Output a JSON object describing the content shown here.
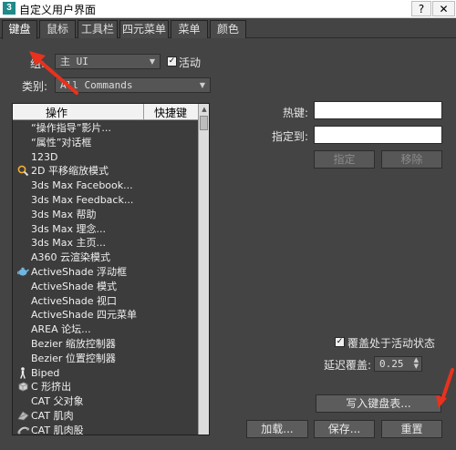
{
  "window": {
    "icon_text": "3",
    "title": "自定义用户界面",
    "help_label": "?",
    "close_label": "✕"
  },
  "tabs": [
    {
      "label": "键盘",
      "active": true
    },
    {
      "label": "鼠标",
      "active": false
    },
    {
      "label": "工具栏",
      "active": false
    },
    {
      "label": "四元菜单",
      "active": false
    },
    {
      "label": "菜单",
      "active": false
    },
    {
      "label": "颜色",
      "active": false
    }
  ],
  "group": {
    "label": "组:",
    "value": "主 UI"
  },
  "active_checkbox": {
    "label": "活动",
    "checked": true,
    "check_glyph": "✓"
  },
  "category": {
    "label": "类别:",
    "value": "All Commands"
  },
  "list": {
    "col_action": "操作",
    "col_shortcut": "快捷键",
    "rows": [
      {
        "text": "“操作指导”影片...",
        "icon": ""
      },
      {
        "text": "“属性”对话框",
        "icon": ""
      },
      {
        "text": "123D",
        "icon": ""
      },
      {
        "text": "2D 平移缩放模式",
        "icon": "magnify-hand-icon"
      },
      {
        "text": "3ds Max Facebook...",
        "icon": ""
      },
      {
        "text": "3ds Max Feedback...",
        "icon": ""
      },
      {
        "text": "3ds Max 帮助",
        "icon": ""
      },
      {
        "text": "3ds Max 理念...",
        "icon": ""
      },
      {
        "text": "3ds Max 主页...",
        "icon": ""
      },
      {
        "text": "A360 云渲染模式",
        "icon": ""
      },
      {
        "text": "ActiveShade 浮动框",
        "icon": "teapot-icon"
      },
      {
        "text": "ActiveShade 模式",
        "icon": ""
      },
      {
        "text": "ActiveShade 视口",
        "icon": ""
      },
      {
        "text": "ActiveShade 四元菜单",
        "icon": ""
      },
      {
        "text": "AREA 论坛...",
        "icon": ""
      },
      {
        "text": "Bezier 缩放控制器",
        "icon": ""
      },
      {
        "text": "Bezier 位置控制器",
        "icon": ""
      },
      {
        "text": "Biped",
        "icon": "biped-icon"
      },
      {
        "text": "C 形挤出",
        "icon": "cube-icon"
      },
      {
        "text": "CAT 父对象",
        "icon": ""
      },
      {
        "text": "CAT 肌肉",
        "icon": "cat-muscle-icon"
      },
      {
        "text": "CAT 肌肉股",
        "icon": "cat-muscle-strand-icon"
      }
    ]
  },
  "hotkey": {
    "label": "热键:",
    "value": ""
  },
  "assigned_to": {
    "label": "指定到:",
    "value": ""
  },
  "buttons": {
    "assign": "指定",
    "remove": "移除",
    "write_keyboard_chart": "写入键盘表...",
    "load": "加载...",
    "save": "保存...",
    "reset": "重置"
  },
  "override_checkbox": {
    "label": "覆盖处于活动状态",
    "checked": true,
    "check_glyph": "✓"
  },
  "delay_override": {
    "label": "延迟覆盖:",
    "value": "0.25"
  },
  "icons": {
    "dropdown_arrow": "▼",
    "spinner_up": "▲",
    "spinner_down": "▼",
    "scroll_up": "▲"
  },
  "colors": {
    "annotation_arrow": "#e8321e"
  }
}
